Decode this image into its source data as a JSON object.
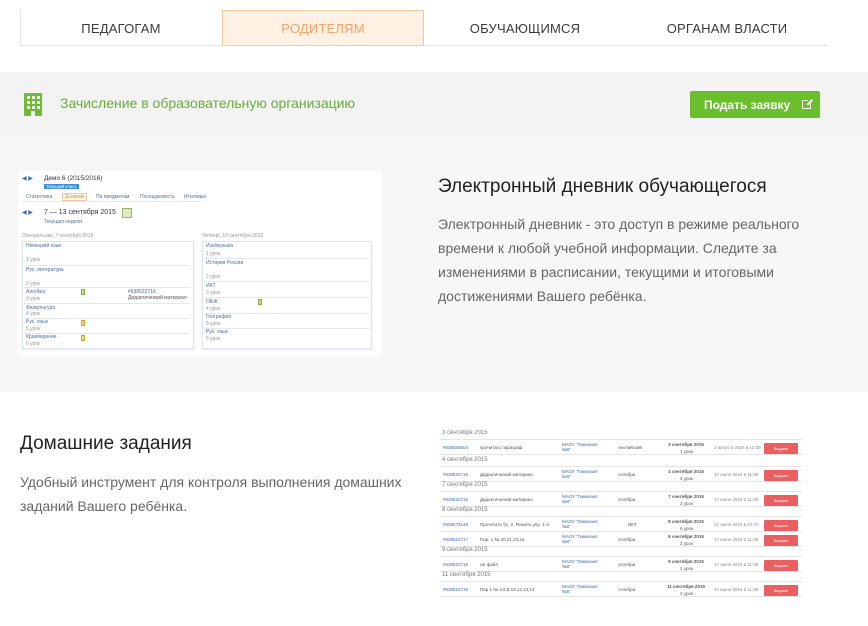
{
  "tabs": [
    {
      "label": "ПЕДАГОГАМ",
      "active": false
    },
    {
      "label": "РОДИТЕЛЯМ",
      "active": true
    },
    {
      "label": "ОБУЧАЮЩИМСЯ",
      "active": false
    },
    {
      "label": "ОРГАНАМ ВЛАСТИ",
      "active": false
    }
  ],
  "banner": {
    "icon": "building-icon",
    "text": "Зачисление в образовательную организацию",
    "button_label": "Подать заявку",
    "button_icon": "external-link-icon"
  },
  "diary_section": {
    "title": "Электронный дневник обучающегося",
    "description": "Электронный дневник - это доступ в режиме реального времени к любой учебной информации. Следите за изменениями в расписании, текущими и итоговыми достижениями Вашего ребёнка.",
    "preview": {
      "student": "Демо 6 (2015/2016)",
      "badge": "Текущий класс",
      "tabs": [
        "Статистика",
        "Дневник",
        "По предметам",
        "Посещаемость",
        "Итоговые"
      ],
      "week": "7 — 13 сентября 2015",
      "week_sub": "Текущая неделя",
      "day1": {
        "title": "Понедельник, 7 сентября 2015",
        "lessons": [
          {
            "name": "Немецкий язык",
            "num": "1 урок"
          },
          {
            "name": "Рус. литература",
            "num": "2 урок"
          },
          {
            "name": "Алгебра",
            "num": "3 урок",
            "hw": "#638522716",
            "note": "Дидактический материал"
          },
          {
            "name": "Физкультура",
            "num": "4 урок"
          },
          {
            "name": "Рус. язык",
            "num": "5 урок"
          },
          {
            "name": "Краеведение",
            "num": "6 урок"
          }
        ]
      },
      "day2": {
        "title": "Четверг, 10 сентября 2015",
        "lessons": [
          {
            "name": "Изо/музыка",
            "num": "1 урок"
          },
          {
            "name": "История России",
            "num": "2 урок"
          },
          {
            "name": "ИКТ",
            "num": "3 урок"
          },
          {
            "name": "ОБЖ",
            "num": "4 урок"
          },
          {
            "name": "География",
            "num": "5 урок"
          },
          {
            "name": "Рус. язык",
            "num": "6 урок"
          }
        ]
      }
    }
  },
  "homework_section": {
    "title": "Домашние задания",
    "description": "Удобный инструмент для контроля выполнения домашних заданий Вашего ребёнка.",
    "preview": {
      "groups": [
        {
          "date": "3 сентября 2015",
          "rows": [
            {
              "id": "#638555604",
              "task": "прочитать параграф",
              "school": "МАОУ \"Гимназия №6\"",
              "subject": "Английский",
              "due": "3 сентября 2015",
              "lesson": "1 урок",
              "issued": "3 августа 2015 в 12:39",
              "action": "Выдано"
            }
          ]
        },
        {
          "date": "4 сентября 2015",
          "rows": [
            {
              "id": "#638522716",
              "task": "Дидактический материал",
              "school": "МАОУ \"Гимназия №6\"",
              "subject": "Алгебра",
              "due": "4 сентября 2015",
              "lesson": "4 урок",
              "issued": "17 июля 2015 в 11:38",
              "action": "Выдано"
            }
          ]
        },
        {
          "date": "7 сентября 2015",
          "rows": [
            {
              "id": "#638522716",
              "task": "Дидактический материал",
              "school": "МАОУ \"Гимназия №6\"",
              "subject": "Алгебра",
              "due": "7 сентября 2015",
              "lesson": "3 урок",
              "issued": "17 июля 2015 в 11:38",
              "action": "Выдано"
            }
          ]
        },
        {
          "date": "8 сентября 2015",
          "rows": [
            {
              "id": "#638573148",
              "task": "Прочитать §1, 2. Решить упр. 1-3",
              "school": "МАОУ \"Гимназия №6\"",
              "subject": "ИКТ",
              "due": "8 сентября 2015",
              "lesson": "6 урок",
              "issued": "21 июля 2015 в 10:27",
              "action": "Выдано"
            },
            {
              "id": "#638522717",
              "task": "Пар. 1 № 20,21,23,24",
              "school": "МАОУ \"Гимназия №6\"",
              "subject": "Алгебра",
              "due": "8 сентября 2015",
              "lesson": "2 урок",
              "issued": "17 июля 2015 в 11:38",
              "action": "Выдано"
            }
          ]
        },
        {
          "date": "9 сентября 2015",
          "rows": [
            {
              "id": "#638522718",
              "task": "см файл",
              "school": "МАОУ \"Гимназия №6\"",
              "subject": "Алгебра",
              "due": "9 сентября 2015",
              "lesson": "2 урок",
              "issued": "17 июля 2015 в 11:38",
              "action": "Выдано"
            }
          ]
        },
        {
          "date": "11 сентября 2015",
          "rows": [
            {
              "id": "#638522719",
              "task": "Пар 1 № 4,6,8,10,12,13,14",
              "school": "МАОУ \"Гимназия №6\"",
              "subject": "Алгебра",
              "due": "11 сентября 2015",
              "lesson": "3 урок",
              "issued": "17 июля 2015 в 11:38",
              "action": "Выдано"
            }
          ]
        }
      ]
    }
  },
  "colors": {
    "accent_green": "#6cbf2c",
    "banner_text": "#69ac39",
    "active_tab_bg": "#fdf1e4",
    "active_tab_text": "#f1a26a",
    "hw_button": "#ea5f5f"
  }
}
